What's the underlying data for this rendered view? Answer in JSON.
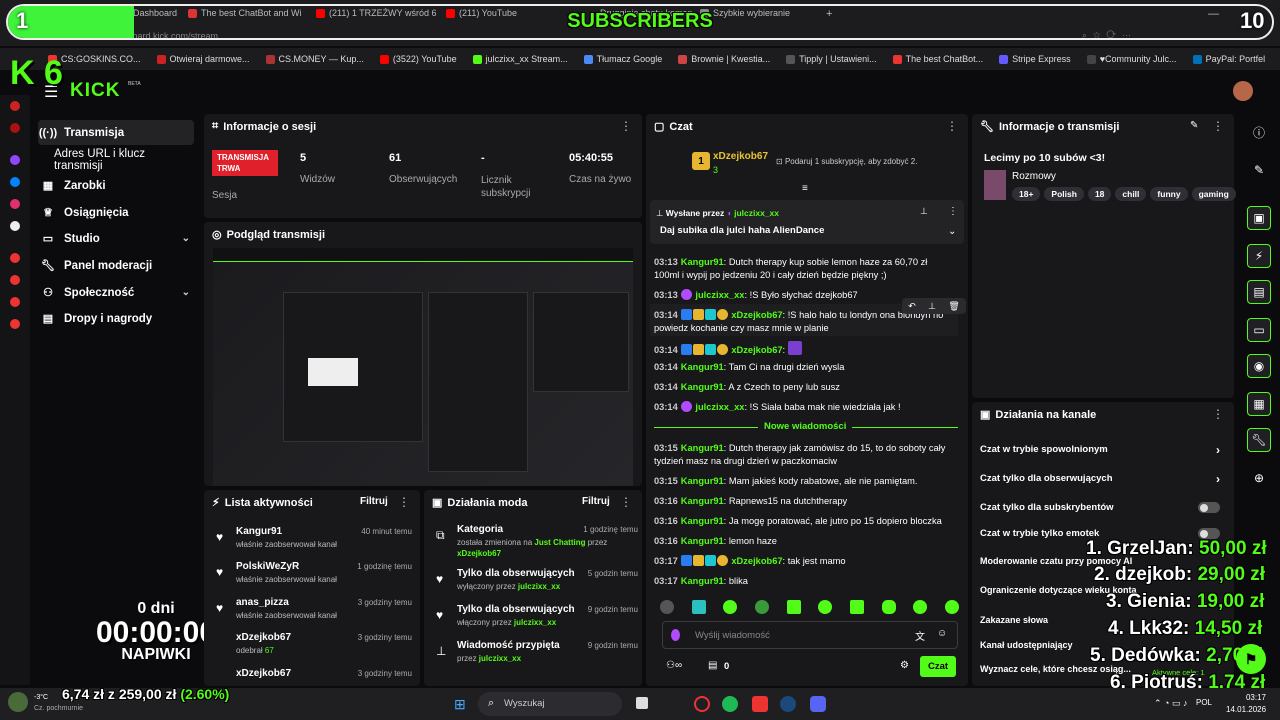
{
  "browser": {
    "tabs": [
      {
        "label": "Dashboard",
        "color": "#53fc18"
      },
      {
        "label": "The best ChatBot and Wi",
        "color": "#d33"
      },
      {
        "label": "(211) 1 TRZEŹWY wśród 6",
        "color": "#f00"
      },
      {
        "label": "(211) YouTube",
        "color": "#f00"
      },
      {
        "label": "Szybkie wybieranie",
        "color": "#888"
      }
    ],
    "tab_partial": "Drugginie chatu komen",
    "new_tab": "+",
    "url": "dashboard.kick.com/stream",
    "bookmarks": [
      {
        "label": "CS:GOSKINS.CO...",
        "color": "#e33"
      },
      {
        "label": "Otwieraj darmowe...",
        "color": "#c22"
      },
      {
        "label": "CS.MONEY — Kup...",
        "color": "#333"
      },
      {
        "label": "(3522) YouTube",
        "color": "#f00"
      },
      {
        "label": "julczixx_xx Stream...",
        "color": "#53fc18"
      },
      {
        "label": "Tłumacz Google",
        "color": "#4a8af4"
      },
      {
        "label": "Brownie | Kwestia...",
        "color": "#c44"
      },
      {
        "label": "Tipply | Ustawieni...",
        "color": "#555"
      },
      {
        "label": "The best ChatBot...",
        "color": "#e33"
      },
      {
        "label": "Stripe Express",
        "color": "#635bff"
      },
      {
        "label": "♥Community Julc...",
        "color": "#444"
      },
      {
        "label": "PayPal: Portfel",
        "color": "#0070ba"
      }
    ]
  },
  "subs_goal": {
    "start": "1",
    "end": "10",
    "title": "SUBSCRIBERS",
    "progress_fraction": 0.1
  },
  "kick": {
    "logo": "KICK",
    "beta": "BETA",
    "k6": "K 6"
  },
  "sidebar": {
    "items": [
      {
        "label": "Transmisja",
        "icon": "broadcast-icon"
      },
      {
        "label": "Adres URL i klucz transmisji"
      },
      {
        "label": "Zarobki",
        "icon": "chart-icon"
      },
      {
        "label": "Osiągnięcia",
        "icon": "trophy-icon"
      },
      {
        "label": "Studio",
        "icon": "studio-icon"
      },
      {
        "label": "Panel moderacji",
        "icon": "wrench-icon"
      },
      {
        "label": "Społeczność",
        "icon": "community-icon"
      },
      {
        "label": "Dropy i nagrody",
        "icon": "gift-icon"
      }
    ]
  },
  "session": {
    "title": "Informacje o sesji",
    "badge": "TRANSMISJA TRWA",
    "badge_label": "Sesja",
    "stats": [
      {
        "value": "5",
        "label": "Widzów"
      },
      {
        "value": "61",
        "label": "Obserwujących"
      },
      {
        "value": "-",
        "label": "Licznik subskrypcji"
      },
      {
        "value": "05:40:55",
        "label": "Czas na żywo"
      }
    ]
  },
  "preview": {
    "title": "Podgląd transmisji"
  },
  "activity": {
    "title": "Lista aktywności",
    "filter": "Filtruj",
    "items": [
      {
        "name": "Kangur91",
        "sub": "właśnie zaobserwował kanał",
        "time": "40 minut temu"
      },
      {
        "name": "PolskiWeZyR",
        "sub": "właśnie zaobserwował kanał",
        "time": "1 godzinę temu"
      },
      {
        "name": "anas_pizza",
        "sub": "właśnie zaobserwował kanał",
        "time": "3 godziny temu"
      },
      {
        "name": "xDzejkob67",
        "sub": "odebrał",
        "sub_value": "67",
        "time": "3 godziny temu"
      },
      {
        "name": "xDzejkob67",
        "sub": "",
        "time": "3 godziny temu"
      }
    ]
  },
  "mod": {
    "title": "Działania moda",
    "filter": "Filtruj",
    "items": [
      {
        "name": "Kategoria",
        "line1": "została zmieniona na",
        "line1b": "Just Chatting",
        "line1c": "przez",
        "by": "xDzejkob67",
        "time": "1 godzinę temu",
        "icon": "category-icon"
      },
      {
        "name": "Tylko dla obserwujących",
        "line1": "wyłączony przez",
        "by": "julczixx_xx",
        "time": "5 godzin temu",
        "icon": "heart-icon"
      },
      {
        "name": "Tylko dla obserwujących",
        "line1": "włączony przez",
        "by": "julczixx_xx",
        "time": "9 godzin temu",
        "icon": "heart-icon"
      },
      {
        "name": "Wiadomość przypięta",
        "line1": "przez",
        "by": "julczixx_xx",
        "time": "9 godzin temu",
        "icon": "pin-icon"
      }
    ]
  },
  "chat": {
    "title": "Czat",
    "gifter": {
      "name": "xDzejkob67",
      "count": "3",
      "note": "Podaruj 1 subskrypcję, aby zdobyć 2."
    },
    "pinned": {
      "label": "Wysłane przez",
      "by": "julczixx_xx",
      "text": "Daj subika dla julci haha AlienDance"
    },
    "messages": [
      {
        "time": "03:13",
        "user": "Kangur91",
        "color": "#53fc18",
        "text": "Dutch therapy kup sobie lemon haze za 60,70 zł 100ml i wypij po jedzeniu 20 i cały dzień będzie piękny ;)"
      },
      {
        "time": "03:13",
        "user": "julczixx_xx",
        "color": "#53fc18",
        "text": "!S Było słychać dzejkob67"
      },
      {
        "time": "03:14",
        "user": "xDzejkob67",
        "color": "#53fc18",
        "text": "!S halo halo tu londyn ona blondyn no powiedz kochanie czy masz mnie w planie"
      },
      {
        "time": "03:14",
        "user": "xDzejkob67",
        "color": "#53fc18",
        "text": ""
      },
      {
        "time": "03:14",
        "user": "Kangur91",
        "color": "#53fc18",
        "text": "Tam Ci na drugi dzień wysla"
      },
      {
        "time": "03:14",
        "user": "Kangur91",
        "color": "#53fc18",
        "text": "A z Czech to peny lub susz"
      },
      {
        "time": "03:14",
        "user": "julczixx_xx",
        "color": "#53fc18",
        "text": "!S Siała baba mak nie wiedziała jak !"
      }
    ],
    "new_messages": "Nowe wiadomości",
    "messages2": [
      {
        "time": "03:15",
        "user": "Kangur91",
        "text": "Dutch therapy jak zamówisz do 15, to do soboty cały tydzień masz na drugi dzień w paczkomaciw"
      },
      {
        "time": "03:15",
        "user": "Kangur91",
        "text": "Mam jakieś kody rabatowe, ale nie pamiętam."
      },
      {
        "time": "03:16",
        "user": "Kangur91",
        "text": "Rapnews15 na dutchtherapy"
      },
      {
        "time": "03:16",
        "user": "Kangur91",
        "text": "Ja mogę poratować, ale jutro po 15 dopiero bloczka"
      },
      {
        "time": "03:16",
        "user": "Kangur91",
        "text": "lemon haze"
      },
      {
        "time": "03:17",
        "user": "xDzejkob67",
        "text": "tak jest mamo"
      },
      {
        "time": "03:17",
        "user": "Kangur91",
        "text": "blika"
      }
    ],
    "input_placeholder": "Wyślij wiadomość",
    "points": "0",
    "send": "Czat"
  },
  "stream_info": {
    "title": "Informacje o transmisji",
    "stream_title": "Lecimy po 10 subów <3!",
    "category": "Rozmowy",
    "tags": [
      "18+",
      "Polish",
      "18",
      "chill",
      "funny",
      "gaming"
    ]
  },
  "channel_actions": {
    "title": "Działania na kanale",
    "items": [
      {
        "label": "Czat w trybie spowolnionym",
        "control": "chevron"
      },
      {
        "label": "Czat tylko dla obserwujących",
        "control": "chevron"
      },
      {
        "label": "Czat tylko dla subskrybentów",
        "control": "toggle"
      },
      {
        "label": "Czat w trybie tylko emotek",
        "control": "toggle"
      },
      {
        "label": "Moderowanie czatu przy pomocy AI",
        "control": ""
      },
      {
        "label": "Ograniczenie dotyczące wieku konta",
        "control": ""
      },
      {
        "label": "Zakazane słowa",
        "control": ""
      },
      {
        "label": "Kanał udostępniający",
        "control": ""
      },
      {
        "label": "Wyznacz cele, które chcesz osiąg...",
        "control": ""
      }
    ],
    "goals_label": "Aktywne cele: 1"
  },
  "tips": [
    {
      "rank": "1.",
      "name": "GrzelJan:",
      "amount": "50,00 zł"
    },
    {
      "rank": "2.",
      "name": "dzejkob:",
      "amount": "29,00 zł"
    },
    {
      "rank": "3.",
      "name": "Gienia:",
      "amount": "19,00 zł"
    },
    {
      "rank": "4.",
      "name": "Lkk32:",
      "amount": "14,50 zł"
    },
    {
      "rank": "5.",
      "name": "Dedówka:",
      "amount": "2,70 zł"
    },
    {
      "rank": "6.",
      "name": "Piotruś:",
      "amount": "1,74 zł"
    }
  ],
  "timer": {
    "days": "0 dni",
    "time": "00:00:00",
    "label": "NAPIWKI"
  },
  "donation_goal": {
    "current": "6,74 zł",
    "sep": "z",
    "target": "259,00 zł",
    "percent": "(2.60%)"
  },
  "taskbar": {
    "weather_temp": "-3°C",
    "weather_desc": "Cz. pochmurnie",
    "search": "Wyszukaj",
    "time": "03:17",
    "date": "14.01.2026",
    "lang": "POL"
  },
  "colors": {
    "kick_green": "#53fc18",
    "live_red": "#e0202a",
    "panel": "#18181b"
  }
}
